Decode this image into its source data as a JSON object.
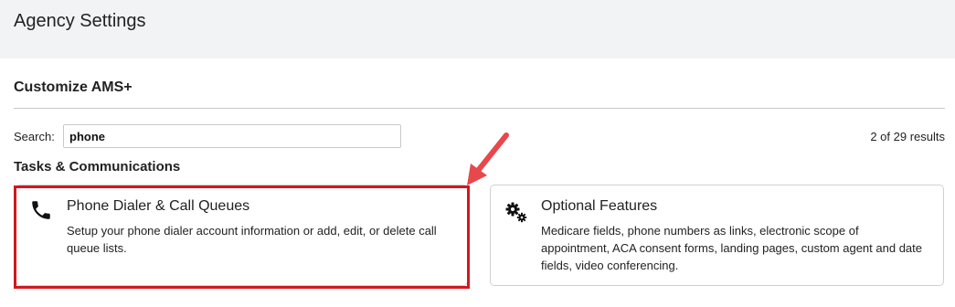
{
  "header": {
    "title": "Agency Settings"
  },
  "section": {
    "title": "Customize AMS+"
  },
  "search": {
    "label": "Search:",
    "value": "phone",
    "placeholder": ""
  },
  "results": {
    "count_text": "2 of 29 results"
  },
  "category": {
    "title": "Tasks & Communications"
  },
  "cards": [
    {
      "title": "Phone Dialer & Call Queues",
      "description": "Setup your phone dialer account information or add, edit, or delete call queue lists.",
      "icon": "phone-icon"
    },
    {
      "title": "Optional Features",
      "description": "Medicare fields, phone numbers as links, electronic scope of appointment, ACA consent forms, landing pages, custom agent and date fields, video conferencing.",
      "icon": "gears-icon"
    }
  ],
  "annotation": {
    "highlight_color": "#d2171e",
    "arrow_color": "#e8474b"
  }
}
